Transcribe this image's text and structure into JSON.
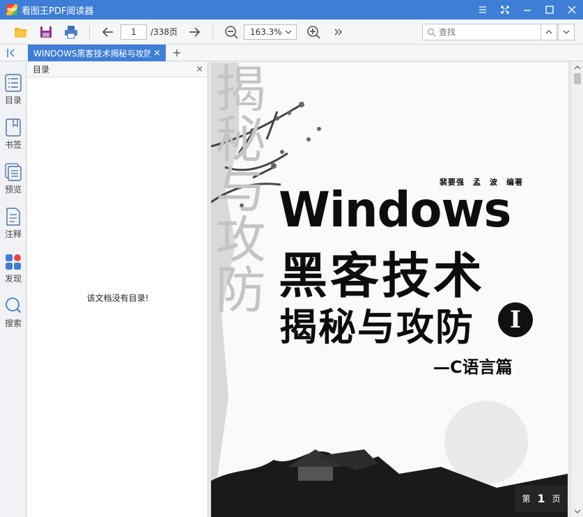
{
  "titlebar": {
    "app_logo_text": "PDF",
    "title": "看图王PDF阅读器"
  },
  "toolbar": {
    "page_current": "1",
    "page_total": "/338页",
    "zoom_value": "163.3%",
    "search_placeholder": "查找"
  },
  "tabs": {
    "doc_tab_label": "WINDOWS黑客技术揭秘与攻防",
    "close_glyph": "×",
    "add_glyph": "+"
  },
  "sidebar": {
    "items": [
      {
        "label": "目录",
        "icon": "outline-icon"
      },
      {
        "label": "书签",
        "icon": "bookmark-icon"
      },
      {
        "label": "预览",
        "icon": "preview-icon"
      },
      {
        "label": "注释",
        "icon": "annotation-icon"
      },
      {
        "label": "发现",
        "icon": "discover-icon"
      },
      {
        "label": "搜索",
        "icon": "search-icon"
      }
    ]
  },
  "outline_panel": {
    "title": "目录",
    "close_glyph": "×",
    "empty_message": "该文档没有目录!"
  },
  "cover": {
    "authors": "裴要强　孟　波　编著",
    "title_line1": "Windows",
    "title_line2": "黑客技术",
    "title_line3": "揭秘与攻防",
    "volume": "I",
    "subtitle": "—C语言篇",
    "watermark_chars": "揭秘与攻防"
  },
  "page_indicator": {
    "prefix": "第",
    "number": "1",
    "suffix": "页"
  },
  "colors": {
    "accent": "#3f7ed6",
    "toolbar_bg": "#f5f6f8",
    "discover_red": "#e9463f",
    "discover_blue": "#3f7ed6"
  }
}
